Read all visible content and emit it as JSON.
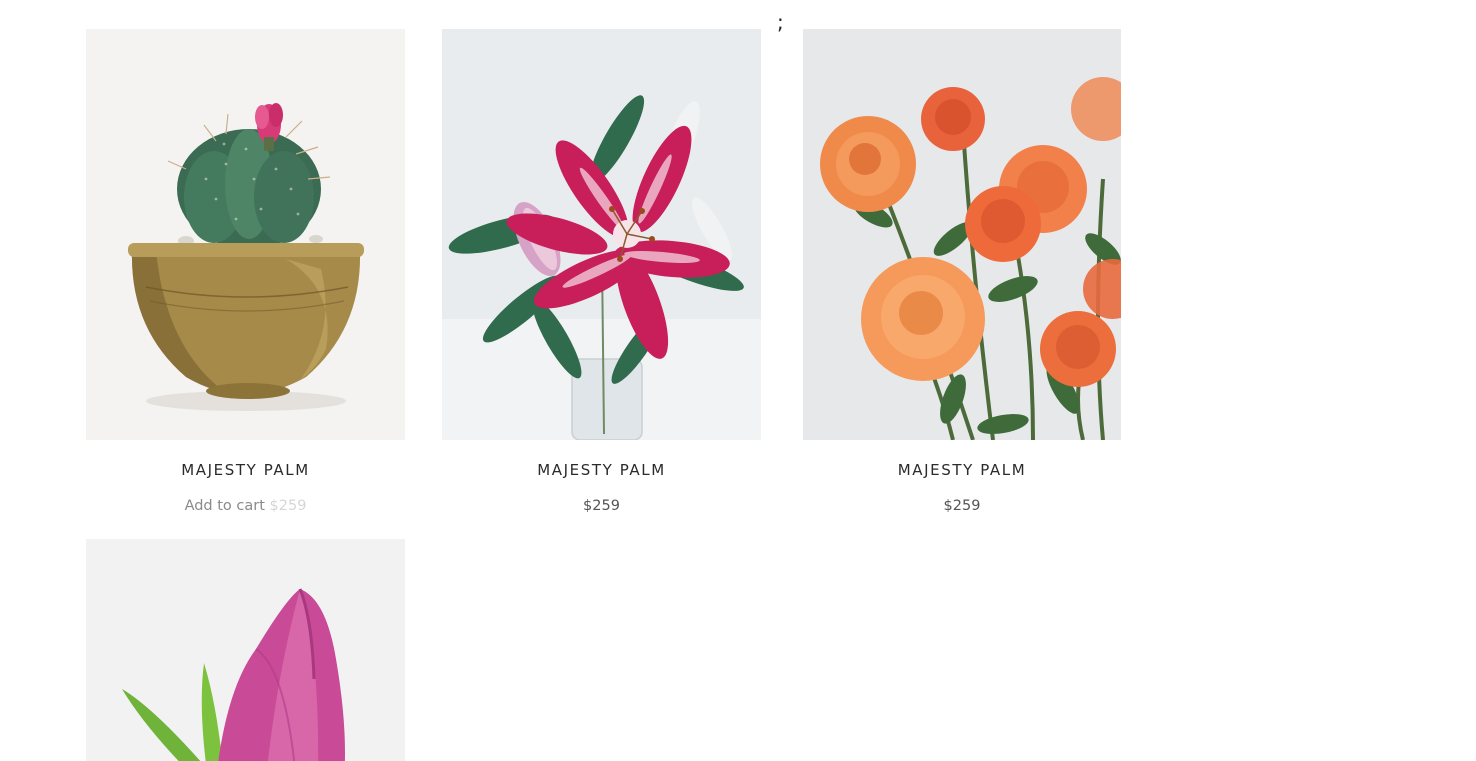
{
  "stray_text": ";",
  "products": [
    {
      "name": "MAJESTY PALM",
      "action_label": "Add to cart",
      "price": "$259",
      "image_icon": "cactus-brass-pot-image"
    },
    {
      "name": "MAJESTY PALM",
      "price": "$259",
      "image_icon": "pink-lily-image"
    },
    {
      "name": "MAJESTY PALM",
      "price": "$259",
      "image_icon": "orange-roses-image"
    },
    {
      "image_icon": "pink-tulip-image"
    }
  ],
  "colors": {
    "title": "#2b2b2b",
    "price": "#555555",
    "muted": "#8a8a8a",
    "ghost": "#d6d6d6"
  }
}
